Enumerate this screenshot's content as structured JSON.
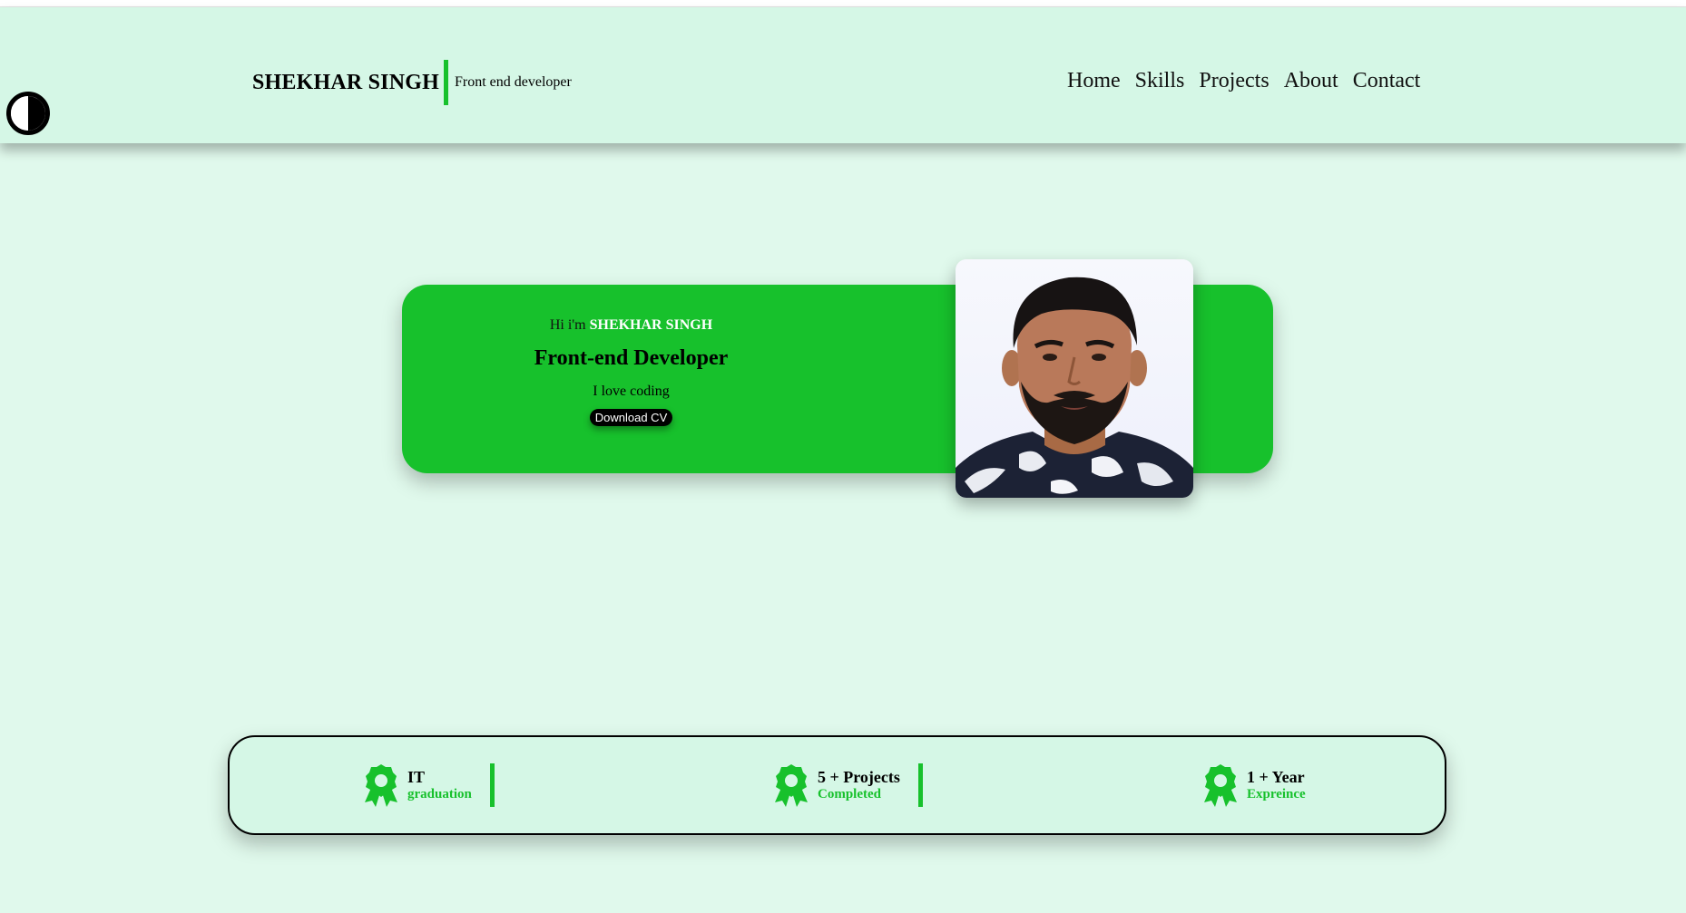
{
  "header": {
    "brand_name": "SHEKHAR SINGH",
    "brand_tagline": "Front end developer",
    "nav": [
      "Home",
      "Skills",
      "Projects",
      "About",
      "Contact"
    ]
  },
  "hero": {
    "greeting": "Hi i'm",
    "greeting_name": "SHEKHAR SINGH",
    "title": "Front-end Developer",
    "subtitle": "I love coding",
    "button_label": "Download CV"
  },
  "stats": [
    {
      "title": "IT",
      "subtitle": "graduation",
      "icon": "award-icon"
    },
    {
      "title": "5 + Projects",
      "subtitle": "Completed",
      "icon": "award-icon"
    },
    {
      "title": "1 + Year",
      "subtitle": "Expreince",
      "icon": "award-icon"
    }
  ],
  "colors": {
    "accent": "#17c12c",
    "header_bg": "#d5f7e6",
    "page_bg": "#e0f9ec"
  }
}
